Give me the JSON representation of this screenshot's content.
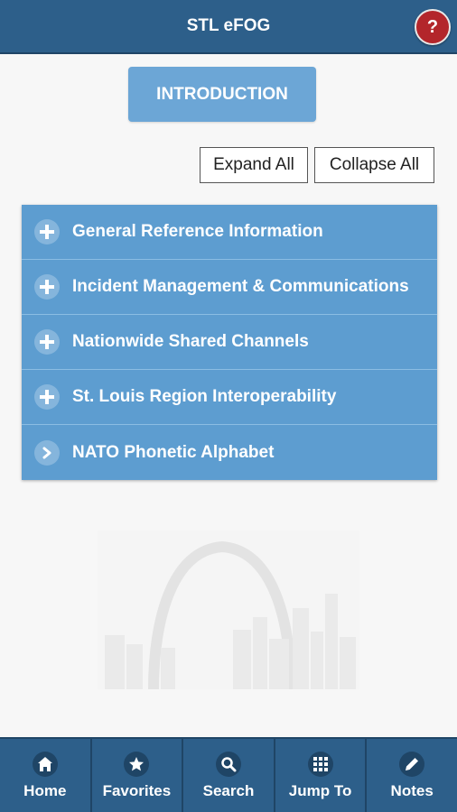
{
  "header": {
    "title": "STL eFOG",
    "help_label": "?"
  },
  "intro_button": "INTRODUCTION",
  "controls": {
    "expand_all": "Expand All",
    "collapse_all": "Collapse All"
  },
  "menu": {
    "items": [
      {
        "label": "General Reference Information",
        "icon": "plus-icon"
      },
      {
        "label": "Incident Management & Communications",
        "icon": "plus-icon"
      },
      {
        "label": "Nationwide Shared Channels",
        "icon": "plus-icon"
      },
      {
        "label": "St. Louis Region Interoperability",
        "icon": "plus-icon"
      },
      {
        "label": "NATO Phonetic Alphabet",
        "icon": "chevron-right-icon"
      }
    ]
  },
  "tabbar": {
    "tabs": [
      {
        "label": "Home",
        "icon": "home-icon"
      },
      {
        "label": "Favorites",
        "icon": "star-icon"
      },
      {
        "label": "Search",
        "icon": "search-icon"
      },
      {
        "label": "Jump To",
        "icon": "grid-icon"
      },
      {
        "label": "Notes",
        "icon": "pencil-icon"
      }
    ]
  },
  "colors": {
    "primary": "#2d5f8a",
    "menu_item": "#5d9dd0",
    "intro_button": "#6ca6d6",
    "help": "#b3262b"
  }
}
